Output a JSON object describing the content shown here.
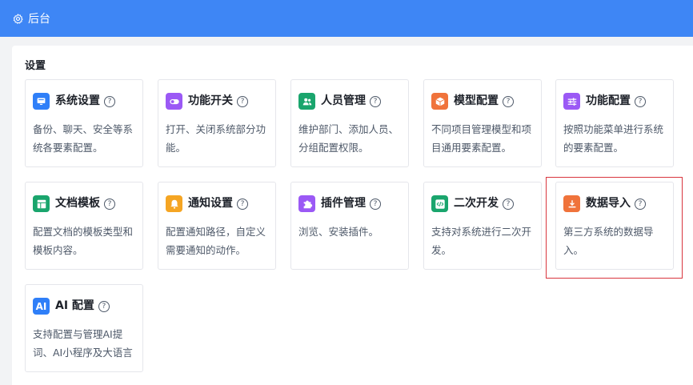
{
  "header": {
    "title": "后台",
    "icon": "gear-icon"
  },
  "section": {
    "title": "设置"
  },
  "cards": [
    {
      "name": "系统设置",
      "desc": "备份、聊天、安全等系统各要素配置。",
      "icon": "monitor-icon",
      "color": "#2f7ff8"
    },
    {
      "name": "功能开关",
      "desc": "打开、关闭系统部分功能。",
      "icon": "toggle-icon",
      "color": "#9b59f5"
    },
    {
      "name": "人员管理",
      "desc": "维护部门、添加人员、分组配置权限。",
      "icon": "users-icon",
      "color": "#1aa56d"
    },
    {
      "name": "模型配置",
      "desc": "不同项目管理模型和项目通用要素配置。",
      "icon": "cube-icon",
      "color": "#f0733b"
    },
    {
      "name": "功能配置",
      "desc": "按照功能菜单进行系统的要素配置。",
      "icon": "sliders-icon",
      "color": "#9b59f5"
    },
    {
      "name": "文档模板",
      "desc": "配置文档的模板类型和模板内容。",
      "icon": "template-icon",
      "color": "#1aa56d"
    },
    {
      "name": "通知设置",
      "desc": "配置通知路径，自定义需要通知的动作。",
      "icon": "bell-icon",
      "color": "#f5a523"
    },
    {
      "name": "插件管理",
      "desc": "浏览、安装插件。",
      "icon": "puzzle-icon",
      "color": "#9b59f5"
    },
    {
      "name": "二次开发",
      "desc": "支持对系统进行二次开发。",
      "icon": "code-icon",
      "color": "#1aa56d"
    },
    {
      "name": "数据导入",
      "desc": "第三方系统的数据导入。",
      "icon": "download-icon",
      "color": "#f0733b"
    },
    {
      "name": "AI 配置",
      "desc": "支持配置与管理AI提词、AI小程序及大语言",
      "icon": "ai-icon",
      "icon_text": "AI",
      "color": "#2f7ff8"
    }
  ]
}
